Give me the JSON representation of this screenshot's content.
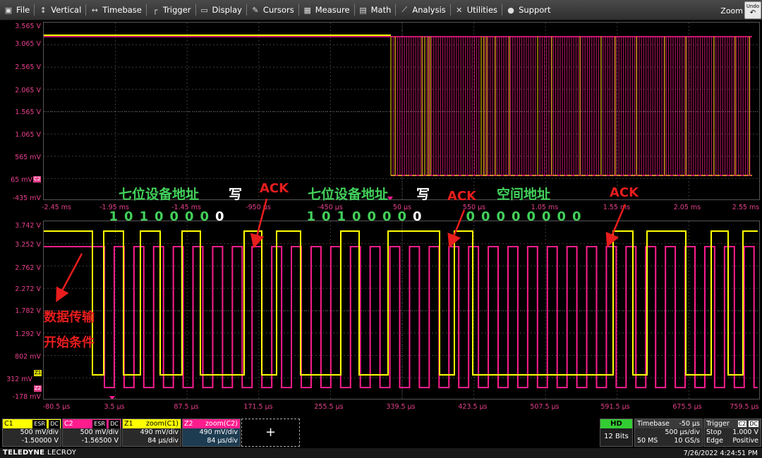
{
  "menu": {
    "items": [
      {
        "label": "File",
        "icon": "file-icon"
      },
      {
        "label": "Vertical",
        "icon": "vertical-arrows-icon"
      },
      {
        "label": "Timebase",
        "icon": "horizontal-arrows-icon"
      },
      {
        "label": "Trigger",
        "icon": "trigger-icon"
      },
      {
        "label": "Display",
        "icon": "display-icon"
      },
      {
        "label": "Cursors",
        "icon": "cursor-icon"
      },
      {
        "label": "Measure",
        "icon": "measure-icon"
      },
      {
        "label": "Math",
        "icon": "math-icon"
      },
      {
        "label": "Analysis",
        "icon": "analysis-icon"
      },
      {
        "label": "Utilities",
        "icon": "utilities-icon"
      },
      {
        "label": "Support",
        "icon": "support-icon"
      }
    ],
    "zoom_label": "Zoom",
    "undo_label": "Undo"
  },
  "upper_grid": {
    "y_labels": [
      "3.565 V",
      "3.065 V",
      "2.565 V",
      "2.065 V",
      "1.565 V",
      "1.065 V",
      "565 mV",
      "65 mV",
      "-435 mV"
    ],
    "x_labels": [
      "-2.45 ms",
      "-1.95 ms",
      "-1.45 ms",
      "-950 µs",
      "-450 µs",
      "50 µs",
      "550 µs",
      "1.05 ms",
      "1.55 ms",
      "2.05 ms",
      "2.55 ms"
    ]
  },
  "lower_grid": {
    "y_labels": [
      "3.742 V",
      "3.252 V",
      "2.762 V",
      "2.272 V",
      "1.782 V",
      "1.292 V",
      "802 mV",
      "312 mV",
      "-178 mV"
    ],
    "x_labels": [
      "-80.5 µs",
      "3.5 µs",
      "87.5 µs",
      "171.5 µs",
      "255.5 µs",
      "339.5 µs",
      "423.5 µs",
      "507.5 µs",
      "591.5 µs",
      "675.5 µs",
      "759.5 µs"
    ]
  },
  "annotations": {
    "addr1": "七位设备地址",
    "write": "写",
    "ack1": "ACK",
    "addr2": "七位设备地址",
    "write2": "写",
    "ack2": "ACK",
    "space_addr": "空间地址",
    "ack3": "ACK",
    "bits1": [
      "1",
      "0",
      "1",
      "0",
      "0",
      "0",
      "0",
      "0"
    ],
    "bits2": [
      "1",
      "0",
      "1",
      "0",
      "0",
      "0",
      "0",
      "0"
    ],
    "bits3": [
      "0",
      "0",
      "0",
      "0",
      "0",
      "0",
      "0",
      "0"
    ],
    "start_line1": "数据传输",
    "start_line2": "开始条件"
  },
  "descriptors": {
    "c1": {
      "name": "C1",
      "tag1": "ESR",
      "tag2": "DC",
      "scale": "500 mV/div",
      "offset": "-1.50000 V",
      "color": "#ffff00"
    },
    "c2": {
      "name": "C2",
      "tag1": "ESR",
      "tag2": "DC",
      "scale": "500 mV/div",
      "offset": "-1.56500 V",
      "color": "#ff1c8d"
    },
    "z1": {
      "name": "Z1",
      "source": "zoom(C1)",
      "scale": "490 mV/div",
      "time": "84 µs/div",
      "color": "#ffff00"
    },
    "z2": {
      "name": "Z2",
      "source": "zoom(C2)",
      "scale": "490 mV/div",
      "time": "84 µs/div",
      "color": "#ff1c8d"
    },
    "add_label": "+"
  },
  "status": {
    "hd_label": "HD",
    "bits_label": "12 Bits",
    "timebase_label": "Timebase",
    "timebase_value": "-50 µs",
    "timebase_div": "500 µs/div",
    "samples": "50 MS",
    "rate": "10 GS/s",
    "trigger_label": "Trigger",
    "trigger_tag": "C2",
    "trigger_coupling": "DC",
    "trigger_mode": "Stop",
    "trigger_level": "1.000 V",
    "trigger_type": "Edge",
    "trigger_slope": "Positive"
  },
  "brand": {
    "name": "TELEDYNE",
    "sub": "LECROY"
  },
  "datetime": "7/26/2022 4:24:51 PM",
  "colors": {
    "c1": "#ffff00",
    "c2": "#ff1c8d",
    "grid": "#3a3a3a",
    "label": "#e6408c"
  }
}
